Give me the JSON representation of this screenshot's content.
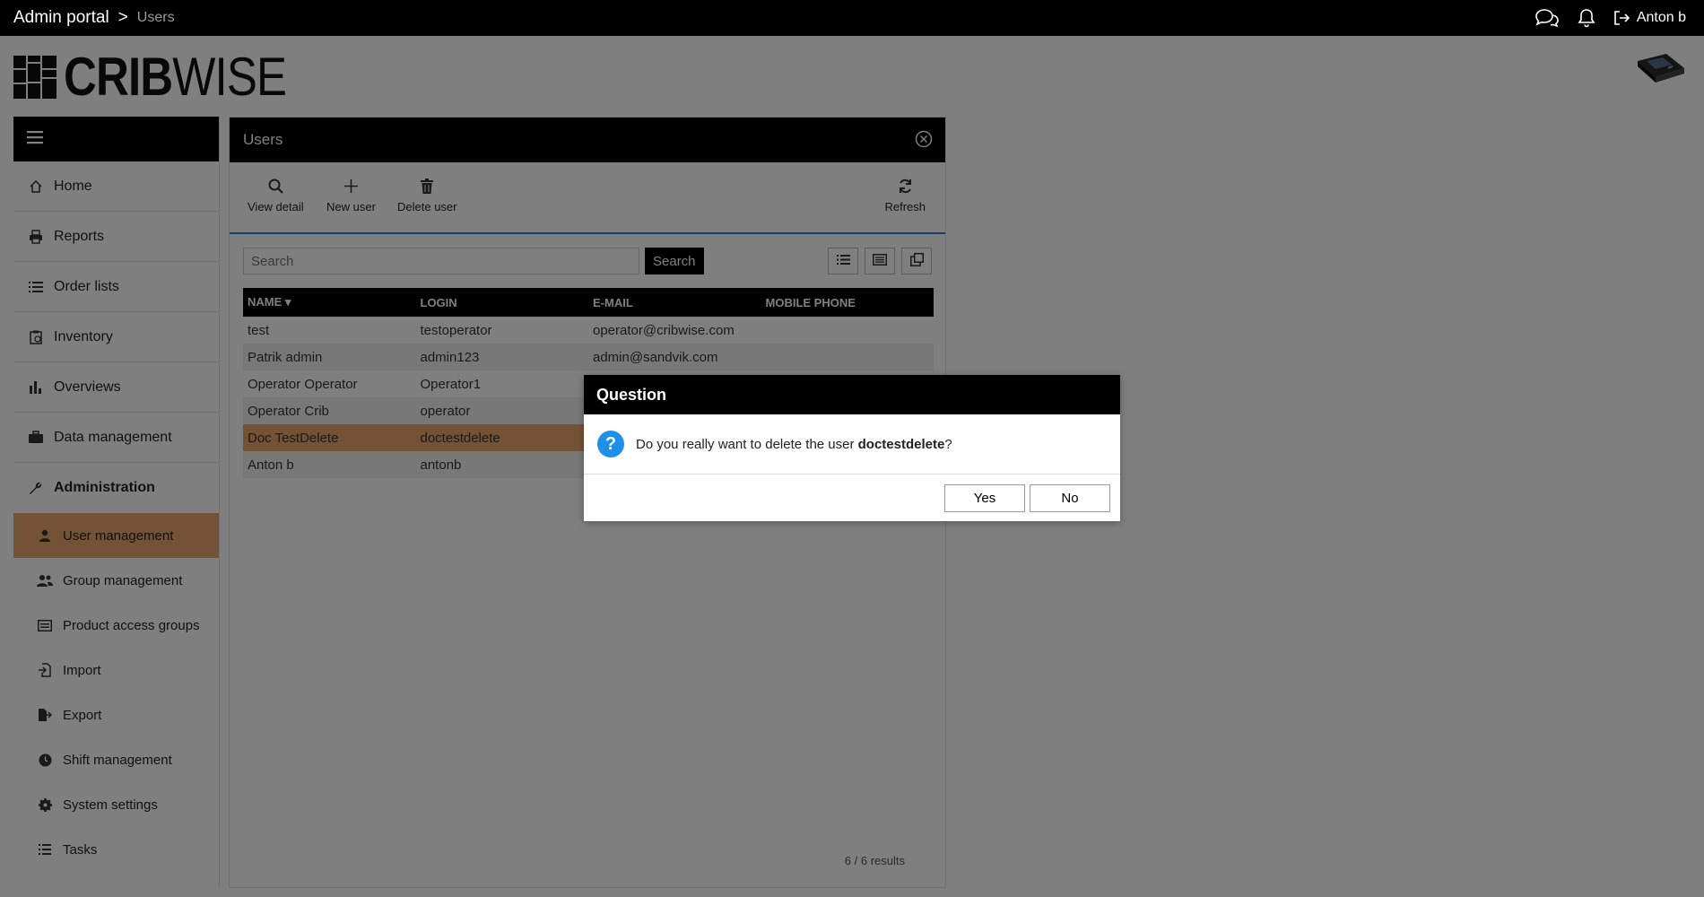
{
  "topbar": {
    "portal": "Admin portal",
    "separator": ">",
    "current": "Users",
    "user_name": "Anton b"
  },
  "logo": {
    "bold": "CRIB",
    "light": "WISE"
  },
  "sidebar": {
    "items": [
      {
        "label": "Home",
        "icon": "home-icon"
      },
      {
        "label": "Reports",
        "icon": "printer-icon"
      },
      {
        "label": "Order lists",
        "icon": "list-icon"
      },
      {
        "label": "Inventory",
        "icon": "clipboard-icon"
      },
      {
        "label": "Overviews",
        "icon": "bar-chart-icon"
      },
      {
        "label": "Data management",
        "icon": "briefcase-icon"
      },
      {
        "label": "Administration",
        "icon": "wrench-icon"
      }
    ],
    "sub_items": [
      {
        "label": "User management",
        "icon": "user-icon",
        "active": true
      },
      {
        "label": "Group management",
        "icon": "users-icon"
      },
      {
        "label": "Product access groups",
        "icon": "card-icon"
      },
      {
        "label": "Import",
        "icon": "file-import-icon"
      },
      {
        "label": "Export",
        "icon": "file-export-icon"
      },
      {
        "label": "Shift management",
        "icon": "clock-icon"
      },
      {
        "label": "System settings",
        "icon": "gear-icon"
      },
      {
        "label": "Tasks",
        "icon": "list-icon"
      }
    ]
  },
  "panel": {
    "title": "Users",
    "toolbar": {
      "view_detail": "View detail",
      "new_user": "New user",
      "delete_user": "Delete user",
      "refresh": "Refresh"
    },
    "search": {
      "placeholder": "Search",
      "button": "Search"
    },
    "columns": [
      "NAME",
      "LOGIN",
      "E-MAIL",
      "MOBILE PHONE"
    ],
    "rows": [
      [
        "test",
        "testoperator",
        "operator@cribwise.com",
        ""
      ],
      [
        "Patrik admin",
        "admin123",
        "admin@sandvik.com",
        ""
      ],
      [
        "Operator Operator",
        "Operator1",
        "",
        ""
      ],
      [
        "Operator Crib",
        "operator",
        "",
        ""
      ],
      [
        "Doc TestDelete",
        "doctestdelete",
        "",
        ""
      ],
      [
        "Anton b",
        "antonb",
        "",
        ""
      ]
    ],
    "results": "6 / 6 results"
  },
  "dialog": {
    "title": "Question",
    "message_prefix": "Do you really want to delete the user ",
    "message_user": "doctestdelete",
    "message_suffix": "?",
    "yes": "Yes",
    "no": "No"
  },
  "colors": {
    "accent": "#e9a46c",
    "header": "#000000",
    "info_icon": "#1e90e8",
    "toolbar_line": "#2f7fd0"
  }
}
